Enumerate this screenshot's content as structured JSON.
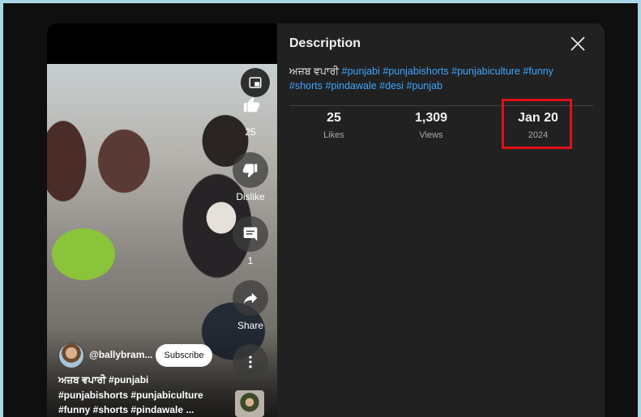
{
  "overlay": {
    "rail": {
      "like_count": "25",
      "dislike_label": "Dislike",
      "comment_count": "1",
      "share_label": "Share"
    },
    "channel": {
      "name": "@ballybram...",
      "subscribe_label": "Subscribe"
    },
    "caption_lines": [
      "ਅਜ਼ਬ ਵਪਾਰੀ #punjabi",
      "#punjabishorts #punjabiculture",
      "#funny #shorts #pindawale ..."
    ]
  },
  "description_panel": {
    "title": "Description",
    "text_prefix": "ਅਜ਼ਬ ਵਪਾਰੀ ",
    "hashtags_line1": "#punjabi #punjabishorts #punjabiculture #funny",
    "hashtags_line2": "#shorts #pindawale #desi #punjab",
    "stats": [
      {
        "value": "25",
        "label": "Likes"
      },
      {
        "value": "1,309",
        "label": "Views"
      },
      {
        "value": "Jan 20",
        "label": "2024"
      }
    ]
  },
  "colors": {
    "panel_bg": "#212121",
    "link": "#3ea6ff",
    "highlight": "#e0101a",
    "page_border": "#a8d8e8"
  }
}
